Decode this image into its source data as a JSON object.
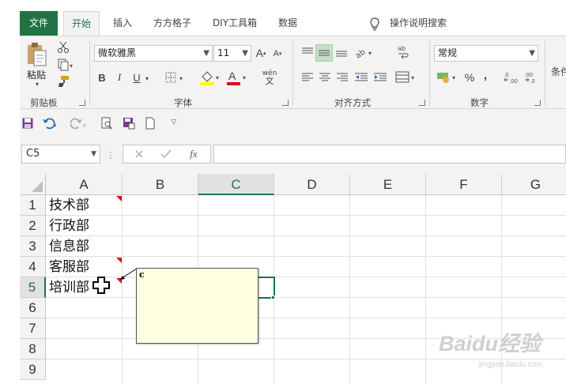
{
  "ribbon_tabs": {
    "file": "文件",
    "home": "开始",
    "insert": "插入",
    "ffgz": "方方格子",
    "diy": "DIY工具箱",
    "data": "数据"
  },
  "tell_me": "操作说明搜索",
  "clipboard": {
    "paste_label": "粘贴",
    "group_label": "剪贴板"
  },
  "font": {
    "name": "微软雅黑",
    "size": "11",
    "bold": "B",
    "italic": "I",
    "underline": "U",
    "wen": "wén",
    "group_label": "字体"
  },
  "alignment": {
    "group_label": "对齐方式"
  },
  "number": {
    "format": "常规",
    "percent": "%",
    "comma": ",",
    "group_label": "数字"
  },
  "styles": {
    "partial_label": "条件"
  },
  "formula_bar": {
    "name_box": "C5",
    "fx": "fx",
    "content": ""
  },
  "grid": {
    "columns": [
      "A",
      "B",
      "C",
      "D",
      "E",
      "F",
      "G"
    ],
    "rows": [
      "1",
      "2",
      "3",
      "4",
      "5",
      "6",
      "7",
      "8",
      "9"
    ],
    "cells": {
      "A1": "技术部",
      "A2": "行政部",
      "A3": "信息部",
      "A4": "客服部",
      "A5": "培训部"
    },
    "active_cell": "C5",
    "comment_text": "c"
  },
  "watermark": {
    "logo": "Baidu经验",
    "url": "jingyan.baidu.com"
  },
  "colors": {
    "accent": "#217346",
    "comment_marker": "#e0001b",
    "comment_bg": "#ffffe1",
    "font_color_bar": "#e0001b",
    "highlight_bar": "#ffff00"
  }
}
